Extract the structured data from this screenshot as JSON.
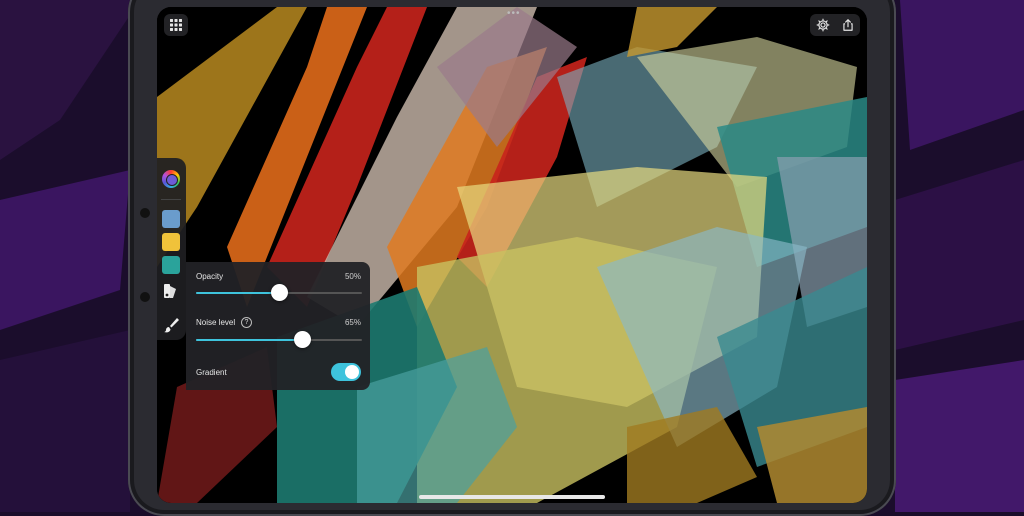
{
  "app": {
    "menu_icon": "grid-icon",
    "settings_icon": "gear-icon",
    "share_icon": "share-icon",
    "grabber_text": "•••"
  },
  "toolbar": {
    "items": [
      {
        "name": "color-picker",
        "icon": "color-wheel-icon"
      },
      {
        "name": "swatch-blue",
        "color": "#6a9ccc"
      },
      {
        "name": "swatch-yellow",
        "color": "#f0c23a"
      },
      {
        "name": "swatch-teal",
        "color": "#2aa39b"
      },
      {
        "name": "palette-tool",
        "icon": "palette-icon"
      },
      {
        "name": "brush-tool",
        "icon": "brush-icon"
      }
    ]
  },
  "panel": {
    "opacity": {
      "label": "Opacity",
      "value_text": "50%",
      "value": 0.5
    },
    "noise": {
      "label": "Noise level",
      "help_icon": "?",
      "value_text": "65%",
      "value": 0.65
    },
    "gradient": {
      "label": "Gradient",
      "enabled": true
    }
  },
  "colors": {
    "accent": "#3ec3dc",
    "background": "#1a0d2a"
  }
}
